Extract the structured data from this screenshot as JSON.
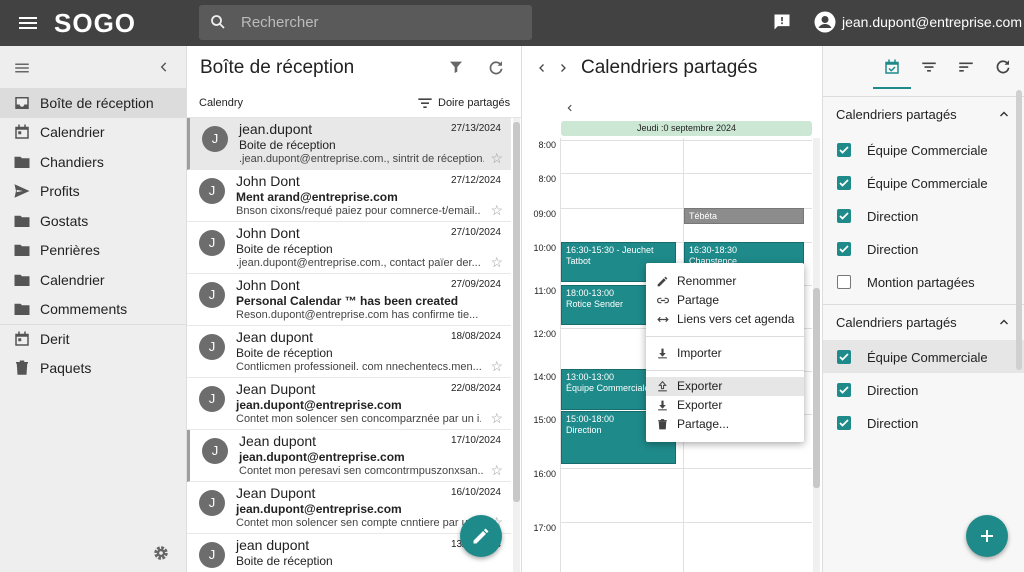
{
  "topbar": {
    "logo": "SOGO",
    "search_placeholder": "Rechercher",
    "user": "jean.dupont@entreprise.com"
  },
  "sidebar": {
    "items": [
      {
        "label": "Boîte de réception",
        "icon": "inbox-icon"
      },
      {
        "label": "Calendrier",
        "icon": "calendar-icon"
      },
      {
        "label": "Chandiers",
        "icon": "folder-icon"
      },
      {
        "label": "Profits",
        "icon": "send-icon"
      },
      {
        "label": "Gostats",
        "icon": "folder-icon"
      },
      {
        "label": "Penrières",
        "icon": "folder-icon"
      },
      {
        "label": "Calendrier",
        "icon": "folder-icon"
      },
      {
        "label": "Commements",
        "icon": "folder-icon"
      },
      {
        "label": "Derit",
        "icon": "calendar-icon"
      },
      {
        "label": "Paquets",
        "icon": "trash-icon"
      }
    ]
  },
  "maillist": {
    "title": "Boîte de réception",
    "calendar_label": "Calendry",
    "sort_label": "Doire partagés",
    "messages": [
      {
        "avatar": "J",
        "from": "jean.dupont",
        "date": "27/13/2024",
        "subject": "Boite de réception",
        "bold": false,
        "preview": ".jean.dupont@entreprise.com., sintrit de réception..."
      },
      {
        "avatar": "J",
        "from": "John Dont",
        "date": "27/12/2024",
        "subject": "Ment arand@entreprise.com",
        "bold": true,
        "preview": "Bnson cixons/requé paiez pour comnerce-t/email..."
      },
      {
        "avatar": "J",
        "from": "John Dont",
        "date": "27/10/2024",
        "subject": "Boite de réception",
        "bold": false,
        "preview": ".jean.dupont@entreprise.com., contact païer der..."
      },
      {
        "avatar": "J",
        "from": "John Dont",
        "date": "27/09/2024",
        "subject": "Personal Calendar ™ has been created",
        "bold": true,
        "preview": "Reson.dupont@entreprise.com has confirme tie..."
      },
      {
        "avatar": "J",
        "from": "Jean dupont",
        "date": "18/08/2024",
        "subject": "Boite de réception",
        "bold": false,
        "preview": "Contlicmen professioneil. com nnechentecs.men..."
      },
      {
        "avatar": "J",
        "from": "Jean Dupont",
        "date": "22/08/2024",
        "subject": "jean.dupont@entreprise.com",
        "bold": true,
        "preview": "Contet mon solencer sen concomparznée par un i..."
      },
      {
        "avatar": "J",
        "from": "Jean dupont",
        "date": "17/10/2024",
        "subject": "jean.dupont@entreprise.com",
        "bold": true,
        "preview": "Contet mon peresavi sen comcontrmpuszonxsan..."
      },
      {
        "avatar": "J",
        "from": "Jean Dupont",
        "date": "16/10/2024",
        "subject": "jean.dupont@entreprise.com",
        "bold": true,
        "preview": "Contet mon solencer sen compte cnntiere par un..."
      },
      {
        "avatar": "J",
        "from": "jean dupont",
        "date": "13/10/2024",
        "subject": "Boite de réception",
        "bold": false,
        "preview": ""
      }
    ]
  },
  "calendar": {
    "title": "Calendriers partagés",
    "day_label": "Jeudi :0 septembre 2024",
    "hours": [
      "8:00",
      "8:00",
      "09:00",
      "10:00",
      "11:00",
      "12:00",
      "14:00",
      "15:00",
      "16:00",
      "17:00"
    ],
    "events": [
      {
        "time": "",
        "title": "Tébéta"
      },
      {
        "time": "16:30-15:30 - Jeuchet",
        "title": "Tatbot"
      },
      {
        "time": "16:30-18:30",
        "title": "Chanstence"
      },
      {
        "time": "18:00-13:00",
        "title": "Rotice Sender"
      },
      {
        "time": "13:00-13:00",
        "title": "Équipe Commerciale"
      },
      {
        "time": "15:00-18:00",
        "title": "Direction"
      }
    ]
  },
  "context_menu": {
    "items": [
      "Renommer",
      "Partage",
      "Liens vers cet agenda",
      "Importer",
      "Exporter",
      "Exporter",
      "Partage..."
    ]
  },
  "right_panel": {
    "section1": "Calendriers partagés",
    "section1_items": [
      {
        "label": "Équipe Commerciale",
        "checked": true
      },
      {
        "label": "Équipe Commerciale",
        "checked": true
      },
      {
        "label": "Direction",
        "checked": true
      },
      {
        "label": "Direction",
        "checked": true
      },
      {
        "label": "Montion partagées",
        "checked": false
      }
    ],
    "section2": "Calendriers partagés",
    "section2_items": [
      {
        "label": "Équipe Commerciale",
        "checked": true
      },
      {
        "label": "Direction",
        "checked": true
      },
      {
        "label": "Direction",
        "checked": true
      }
    ]
  },
  "colors": {
    "accent": "#1f8a8a",
    "topbar": "#424242"
  }
}
